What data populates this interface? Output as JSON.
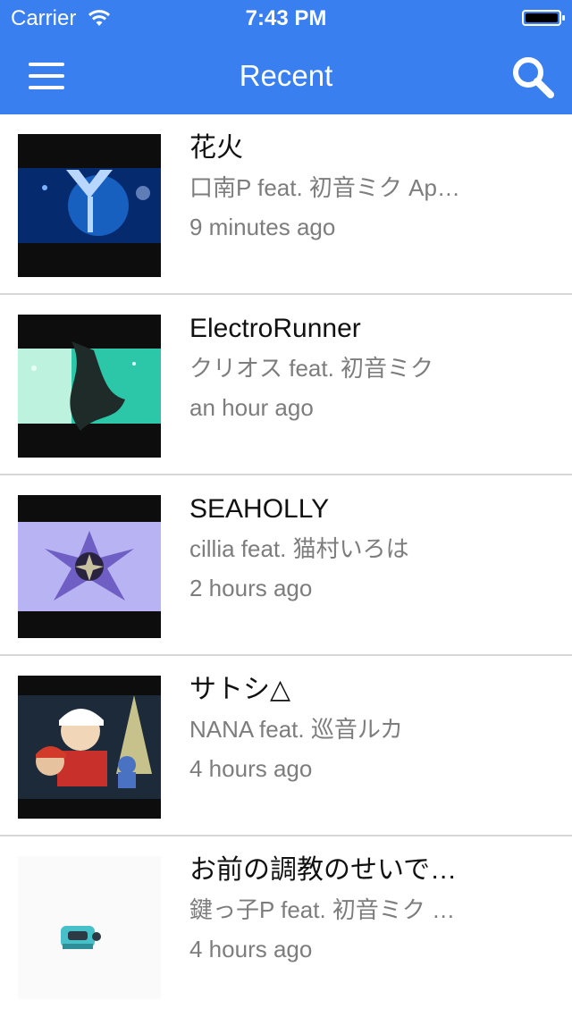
{
  "status_bar": {
    "carrier": "Carrier",
    "time": "7:43 PM",
    "wifi_icon": "wifi-icon",
    "battery_icon": "battery-icon"
  },
  "navbar": {
    "title": "Recent",
    "menu_icon": "hamburger-menu-icon",
    "search_icon": "search-icon",
    "background_color": "#3a7ff0"
  },
  "items": [
    {
      "title": "花火",
      "artist": "口南P feat. 初音ミク Ap…",
      "ago": "9 minutes ago"
    },
    {
      "title": "ElectroRunner",
      "artist": "クリオス feat. 初音ミク",
      "ago": "an hour ago"
    },
    {
      "title": "SEAHOLLY",
      "artist": "cillia feat. 猫村いろは",
      "ago": "2 hours ago"
    },
    {
      "title": "サトシ△",
      "artist": "NANA feat. 巡音ルカ",
      "ago": "4 hours ago"
    },
    {
      "title": "お前の調教のせいで…",
      "artist": "鍵っ子P feat. 初音ミク …",
      "ago": "4 hours ago"
    }
  ]
}
